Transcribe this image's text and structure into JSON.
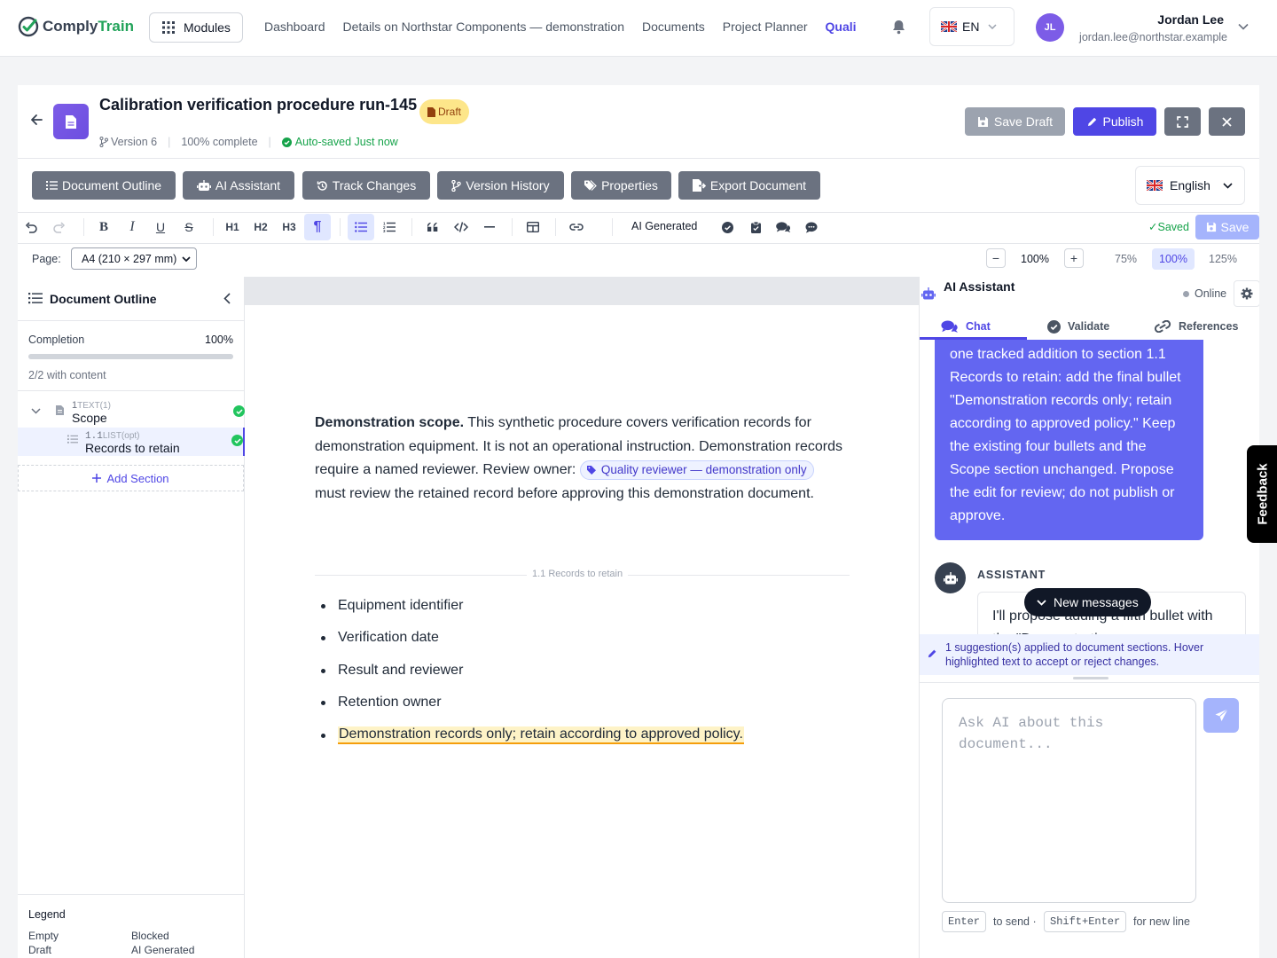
{
  "nav": {
    "logo_part1": "Comply",
    "logo_part2": "Train",
    "modules_label": "Modules",
    "links": [
      "Dashboard",
      "Details on Northstar Components — demonstration",
      "Documents",
      "Project Planner",
      "Quali"
    ],
    "language": "EN",
    "user": {
      "initials": "JL",
      "name": "Jordan Lee",
      "email": "jordan.lee@northstar.example"
    }
  },
  "document": {
    "title": "Calibration verification procedure run-145",
    "status_badge": "Draft",
    "version": "Version 6",
    "completion": "100% complete",
    "autosave": "Auto-saved Just now",
    "save_draft_label": "Save Draft",
    "publish_label": "Publish"
  },
  "tabs": [
    "Document Outline",
    "AI Assistant",
    "Track Changes",
    "Version History",
    "Properties",
    "Export Document"
  ],
  "language_select": "English",
  "toolbar": {
    "h1": "H1",
    "h2": "H2",
    "h3": "H3",
    "ai_generated": "AI Generated",
    "saved": "Saved",
    "save_label": "Save"
  },
  "page_settings": {
    "page_label": "Page:",
    "page_size": "A4 (210 × 297 mm)",
    "zoom_minus": "−",
    "zoom_plus": "+",
    "zoom": "100%",
    "zoom_options": [
      "75%",
      "100%",
      "125%"
    ],
    "zoom_selected": "100%"
  },
  "outline": {
    "title": "Document Outline",
    "completion_label": "Completion",
    "completion_value": "100%",
    "completion_fraction": 1.0,
    "with_content": "2/2 with content",
    "nodes": [
      {
        "num": "1",
        "type": "TEXT(1)",
        "label": "Scope"
      },
      {
        "num": "1.1",
        "type": "LIST(opt)",
        "label": "Records to retain"
      }
    ],
    "add_section": "Add Section",
    "legend_title": "Legend",
    "legend_items": [
      "Empty",
      "Blocked",
      "Draft",
      "AI Generated"
    ]
  },
  "editor": {
    "scope_bold": "Demonstration scope.",
    "scope_text1": " This synthetic procedure covers verification records for demonstration equipment. It is not an operational instruction. Demonstration records require a named reviewer. Review owner: ",
    "chip": "Quality reviewer — demonstration only",
    "scope_text2": " must review the retained record before ap­proving this demonstration document.",
    "section_divider": "1.1    Records to retain",
    "bullets": [
      "Equipment identifier",
      "Verification date",
      "Result and reviewer",
      "Retention owner"
    ],
    "tracked_bullet": "Demonstration records only; retain according to approved policy."
  },
  "ai_panel": {
    "title": "AI Assistant",
    "status": "Online",
    "tabs": [
      "Chat",
      "Validate",
      "References"
    ],
    "user_message": "one tracked addition to section 1.1 Records to retain: add the final bullet \"Demonstration records only; retain according to approved policy.\" Keep the existing four bullets and the Scope section unchanged. Propose the edit for review; do not publish or approve.",
    "assistant_label": "ASSISTANT",
    "assistant_message": "I'll propose adding a fifth bullet with the \"Demonstration...",
    "new_messages": "New messages",
    "suggestion_notice": "1 suggestion(s) applied to document sections. Hover highlighted text to accept or reject changes.",
    "input_placeholder": "Ask AI about this document...",
    "hint_enter_key": "Enter",
    "hint_enter_text": "to send ·",
    "hint_shift_key": "Shift+Enter",
    "hint_shift_text": "for new line"
  },
  "feedback_label": "Feedback",
  "colors": {
    "accent": "#4f46e5",
    "success": "#22c55e",
    "draft": "#fde68a",
    "user_bubble": "#6366f1"
  }
}
